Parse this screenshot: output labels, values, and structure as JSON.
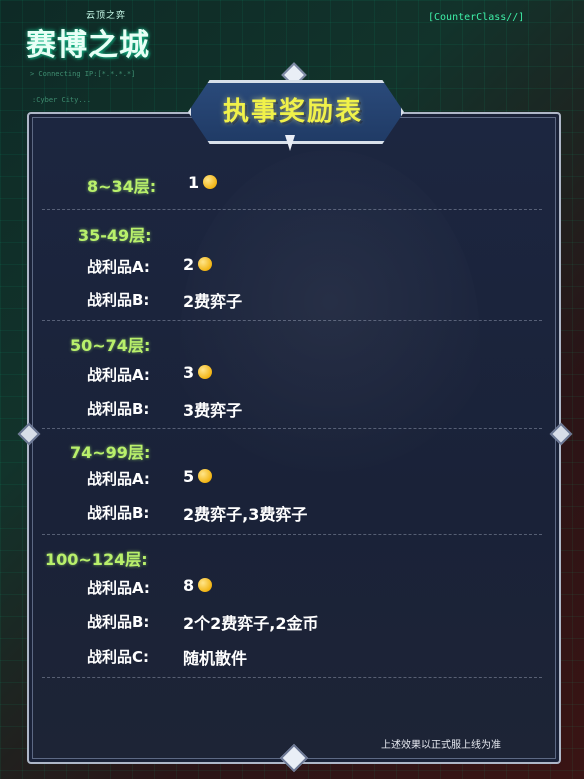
{
  "header": {
    "logo_small": "云顶之弈",
    "logo_big": "赛博之城",
    "tag": "[CounterClass//]",
    "connecting": "> Connecting IP:[*.*.*.*]",
    "cyber_city": ":Cyber City..."
  },
  "title": "执事奖励表",
  "sections": [
    {
      "range": "8~34层:",
      "rewards": [
        {
          "value": "1",
          "coin": true
        }
      ]
    },
    {
      "range": "35-49层:",
      "rewards": [
        {
          "label": "战利品A:",
          "value": "2",
          "coin": true
        },
        {
          "label": "战利品B:",
          "value": "2费弈子",
          "coin": false
        }
      ]
    },
    {
      "range": "50~74层:",
      "rewards": [
        {
          "label": "战利品A:",
          "value": "3",
          "coin": true
        },
        {
          "label": "战利品B:",
          "value": "3费弈子",
          "coin": false
        }
      ]
    },
    {
      "range": "74~99层:",
      "rewards": [
        {
          "label": "战利品A:",
          "value": "5",
          "coin": true
        },
        {
          "label": "战利品B:",
          "value": "2费弈子,3费弈子",
          "coin": false
        }
      ]
    },
    {
      "range": "100~124层:",
      "rewards": [
        {
          "label": "战利品A:",
          "value": "8",
          "coin": true
        },
        {
          "label": "战利品B:",
          "value": "2个2费弈子,2金币",
          "coin": false
        },
        {
          "label": "战利品C:",
          "value": "随机散件",
          "coin": false
        }
      ]
    }
  ],
  "footer": "上述效果以正式服上线为准",
  "colors": {
    "heading": "#b9f06b",
    "title": "#f0f14a",
    "panel": "#1a2238",
    "coin": "#f2b514"
  }
}
